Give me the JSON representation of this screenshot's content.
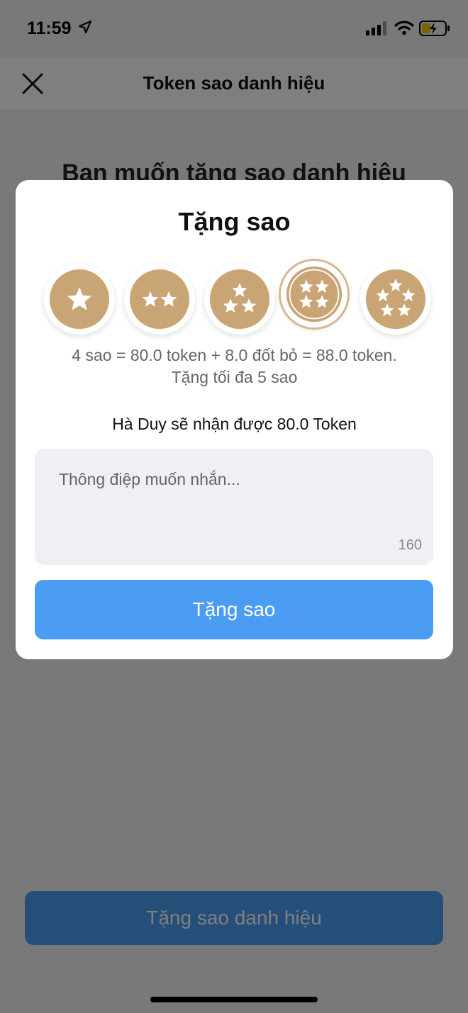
{
  "status_bar": {
    "time": "11:59"
  },
  "nav": {
    "title": "Token sao danh hiệu"
  },
  "page": {
    "heading": "Bạn muốn tặng sao danh hiệu",
    "bottom_button_label": "Tặng sao danh hiệu"
  },
  "dialog": {
    "title": "Tặng sao",
    "star_options": [
      {
        "stars": 1
      },
      {
        "stars": 2
      },
      {
        "stars": 3
      },
      {
        "stars": 4,
        "selected": true
      },
      {
        "stars": 5
      }
    ],
    "price_text": "4 sao = 80.0 token + 8.0 đốt bỏ = 88.0 token. Tặng tối đa 5 sao",
    "receive_text": "Hà Duy sẽ nhận được 80.0 Token",
    "message_placeholder": "Thông điệp muốn nhắn...",
    "char_count": "160",
    "submit_label": "Tặng sao"
  },
  "colors": {
    "accent_blue": "#4b9df3",
    "coin_gold": "#c9a475",
    "overlay": "rgba(0,0,0,0.5)"
  },
  "icons": {
    "close": "close-icon",
    "location": "location-arrow-icon",
    "signal": "cellular-signal-icon",
    "wifi": "wifi-icon",
    "battery": "battery-charging-icon",
    "star": "star-icon"
  }
}
